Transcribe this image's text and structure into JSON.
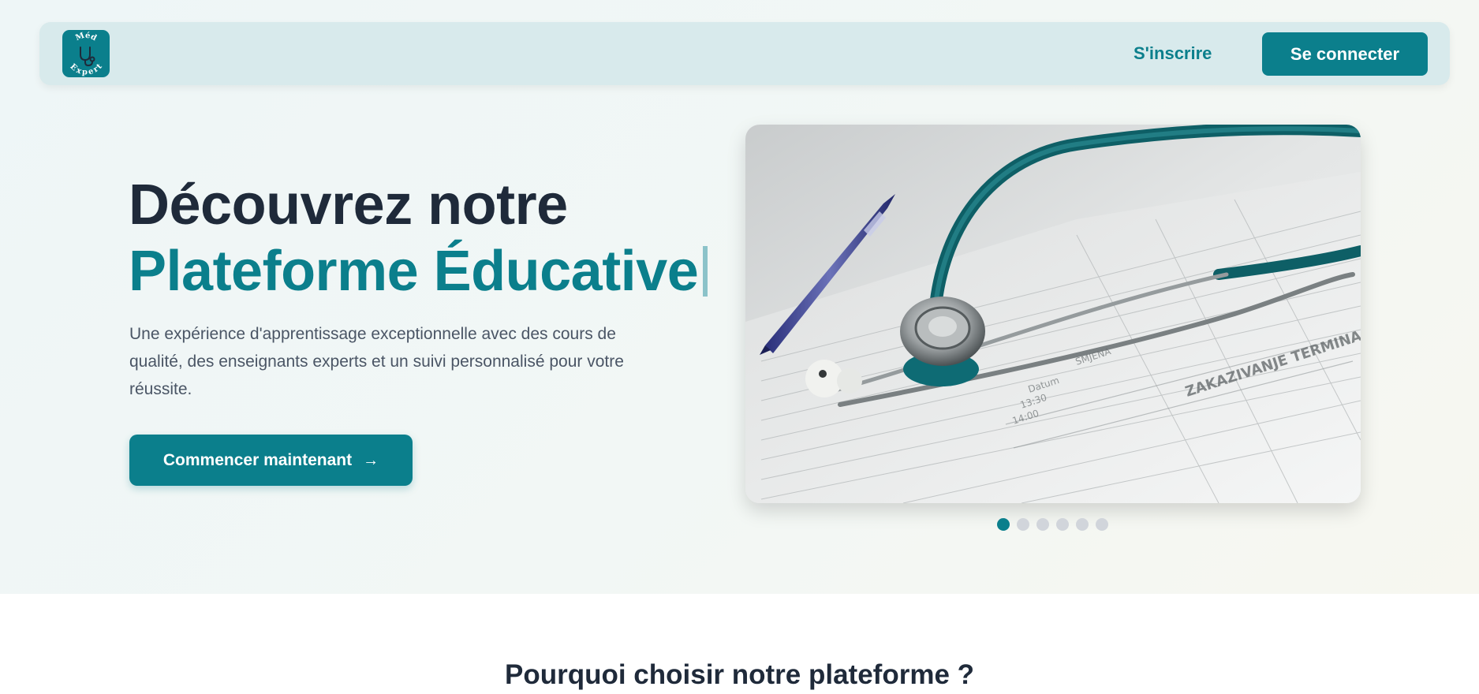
{
  "brand": {
    "logo_line1": "Méd",
    "logo_line2": "Expert",
    "icon": "stethoscope-icon",
    "color": "#0b7f8c"
  },
  "nav": {
    "signup_label": "S'inscrire",
    "login_label": "Se connecter"
  },
  "hero": {
    "title_line1": "Découvrez notre",
    "title_line2": "Plateforme Éducative",
    "description": "Une expérience d'apprentissage exceptionnelle avec des cours de qualité, des enseignants experts et un suivi personnalisé pour votre réussite.",
    "cta_label": "Commencer maintenant",
    "cta_icon": "arrow-right-icon"
  },
  "carousel": {
    "slide_count": 6,
    "active_index": 0
  },
  "features": {
    "title": "Pourquoi choisir notre plateforme ?"
  },
  "colors": {
    "primary": "#0b7f8c",
    "heading": "#1f2a3a",
    "body_text": "#4a5565",
    "dot_inactive": "#d1d5db"
  }
}
